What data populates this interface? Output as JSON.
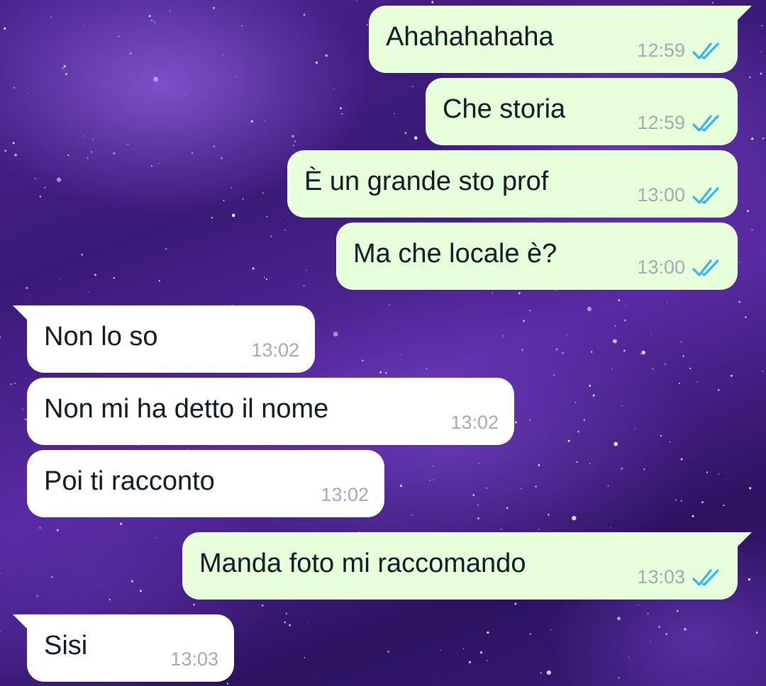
{
  "chat": {
    "theme": {
      "outgoing_bubble": "#e7ffdb",
      "incoming_bubble": "#ffffff",
      "read_tick": "#34b7f1",
      "time_text": "#a3abb0",
      "wallpaper": "purple-starfield"
    },
    "messages": [
      {
        "direction": "out",
        "text": "Ahahahahaha",
        "time": "12:59",
        "status": "read-icon"
      },
      {
        "direction": "out",
        "text": "Che storia",
        "time": "12:59",
        "status": "read-icon"
      },
      {
        "direction": "out",
        "text": "È un grande sto prof",
        "time": "13:00",
        "status": "read-icon"
      },
      {
        "direction": "out",
        "text": "Ma che locale è?",
        "time": "13:00",
        "status": "read-icon"
      },
      {
        "direction": "in",
        "text": "Non lo so",
        "time": "13:02"
      },
      {
        "direction": "in",
        "text": "Non mi ha detto il nome",
        "time": "13:02"
      },
      {
        "direction": "in",
        "text": "Poi ti racconto",
        "time": "13:02"
      },
      {
        "direction": "out",
        "text": "Manda foto mi raccomando",
        "time": "13:03",
        "status": "read-icon"
      },
      {
        "direction": "in",
        "text": "Sisi",
        "time": "13:03"
      }
    ]
  }
}
